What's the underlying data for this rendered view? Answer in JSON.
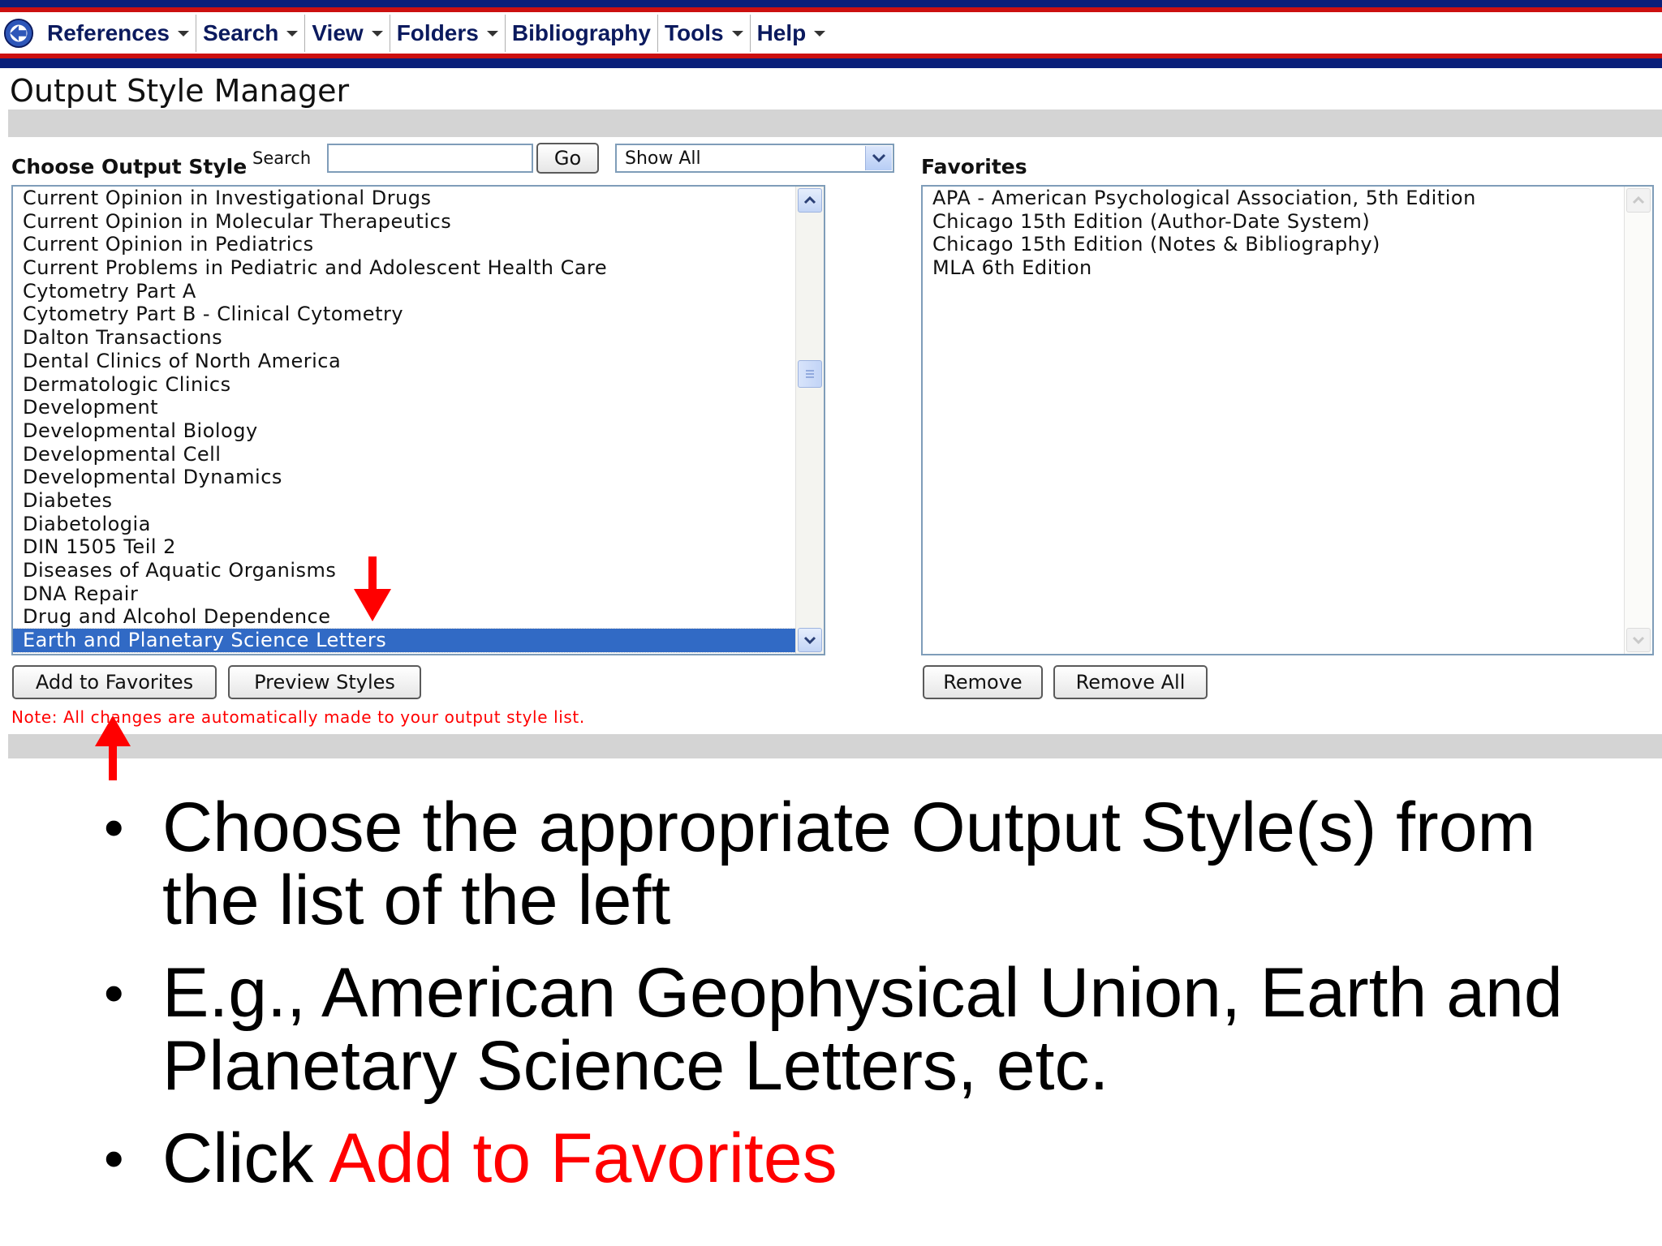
{
  "menu": {
    "items": [
      {
        "label": "References",
        "has_caret": true
      },
      {
        "label": "Search",
        "has_caret": true
      },
      {
        "label": "View",
        "has_caret": true
      },
      {
        "label": "Folders",
        "has_caret": true
      },
      {
        "label": "Bibliography",
        "has_caret": false
      },
      {
        "label": "Tools",
        "has_caret": true
      },
      {
        "label": "Help",
        "has_caret": true
      }
    ]
  },
  "page_title": "Output Style Manager",
  "left": {
    "heading": "Choose Output Style",
    "search_label": "Search",
    "search_value": "",
    "go_label": "Go",
    "filter_value": "Show All",
    "styles": [
      "Current Opinion in Investigational Drugs",
      "Current Opinion in Molecular Therapeutics",
      "Current Opinion in Pediatrics",
      "Current Problems in Pediatric and Adolescent Health Care",
      "Cytometry Part A",
      "Cytometry Part B - Clinical Cytometry",
      "Dalton Transactions",
      "Dental Clinics of North America",
      "Dermatologic Clinics",
      "Development",
      "Developmental Biology",
      "Developmental Cell",
      "Developmental Dynamics",
      "Diabetes",
      "Diabetologia",
      "DIN 1505 Teil 2",
      "Diseases of Aquatic Organisms",
      "DNA Repair",
      "Drug and Alcohol Dependence",
      "Earth and Planetary Science Letters"
    ],
    "selected_style": "Earth and Planetary Science Letters",
    "add_label": "Add to Favorites",
    "preview_label": "Preview Styles",
    "note": "Note: All changes are automatically made to your output style list."
  },
  "right": {
    "heading": "Favorites",
    "favorites": [
      "APA - American Psychological Association, 5th Edition",
      "Chicago 15th Edition (Author-Date System)",
      "Chicago 15th Edition (Notes & Bibliography)",
      "MLA 6th Edition"
    ],
    "remove_label": "Remove",
    "remove_all_label": "Remove All"
  },
  "bullets": {
    "b1": "Choose the appropriate Output Style(s) from the list of the left",
    "b2": "E.g., American Geophysical Union, Earth and Planetary Science Letters, etc.",
    "b3_prefix": "Click ",
    "b3_highlight": "Add to Favorites"
  },
  "colors": {
    "menu_blue": "#0a1f7a",
    "menu_red": "#cc1010",
    "selection": "#316ac5",
    "note_red": "#ff0000",
    "annotation_arrow": "#ff0000"
  }
}
